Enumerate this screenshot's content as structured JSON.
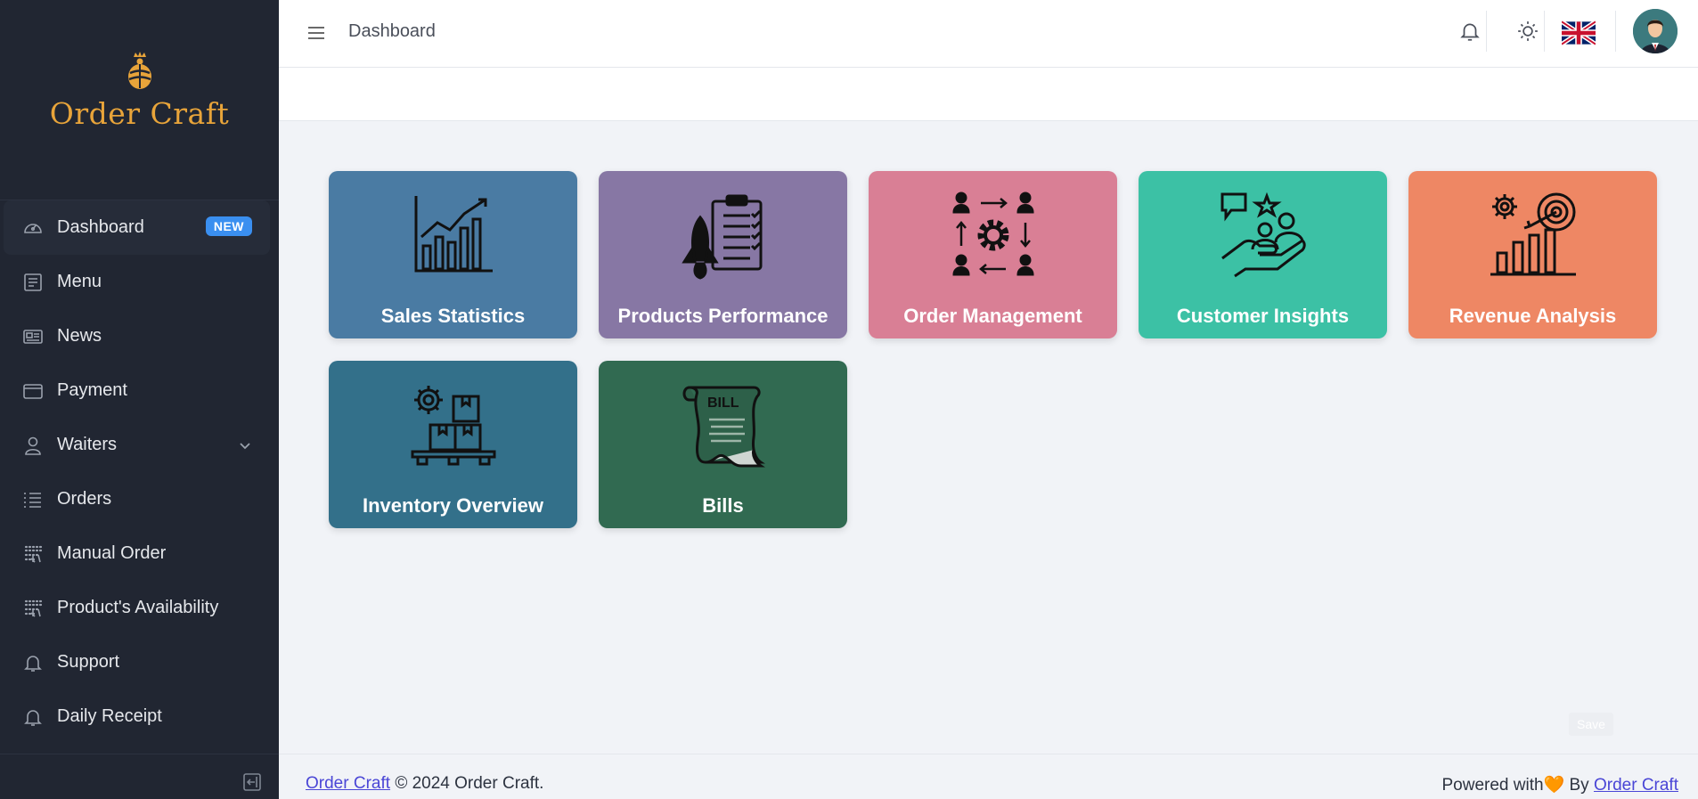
{
  "brand": {
    "name": "Order Craft"
  },
  "header": {
    "title": "Dashboard"
  },
  "sidebar": {
    "items": [
      {
        "label": "Dashboard",
        "icon": "speedometer-icon",
        "active": true,
        "badge": "NEW"
      },
      {
        "label": "Menu",
        "icon": "menu-doc-icon"
      },
      {
        "label": "News",
        "icon": "newspaper-icon"
      },
      {
        "label": "Payment",
        "icon": "wallet-icon"
      },
      {
        "label": "Waiters",
        "icon": "person-icon",
        "has_submenu": true
      },
      {
        "label": "Orders",
        "icon": "list-icon"
      },
      {
        "label": "Manual Order",
        "icon": "dots-grid-icon"
      },
      {
        "label": "Product's Availability",
        "icon": "dots-grid-icon"
      },
      {
        "label": "Support",
        "icon": "bell-icon"
      },
      {
        "label": "Daily Receipt",
        "icon": "bell-icon"
      }
    ]
  },
  "cards": [
    {
      "label": "Sales Statistics",
      "color": "#4a7ba3",
      "icon": "bar-chart-icon"
    },
    {
      "label": "Products Performance",
      "color": "#8777a4",
      "icon": "rocket-clipboard-icon"
    },
    {
      "label": "Order Management",
      "color": "#d97f95",
      "icon": "gear-network-icon"
    },
    {
      "label": "Customer Insights",
      "color": "#3cc1a5",
      "icon": "customer-hand-icon"
    },
    {
      "label": "Revenue Analysis",
      "color": "#ee8764",
      "icon": "target-chart-icon"
    },
    {
      "label": "Inventory Overview",
      "color": "#33708a",
      "icon": "boxes-pallet-icon"
    },
    {
      "label": "Bills",
      "color": "#316a51",
      "icon": "bill-scroll-icon"
    }
  ],
  "save_label": "Save",
  "footer": {
    "brand_link": "Order Craft",
    "copyright": "© 2024 Order Craft.",
    "powered_prefix": "Powered with",
    "heart": "🧡",
    "by_text": "By",
    "powered_link": "Order Craft"
  },
  "colors": {
    "sidebar_bg": "#212632",
    "brand": "#e8a43a",
    "badge": "#3a8ff0",
    "page_bg": "#f1f3f7",
    "link": "#4a46d6"
  }
}
